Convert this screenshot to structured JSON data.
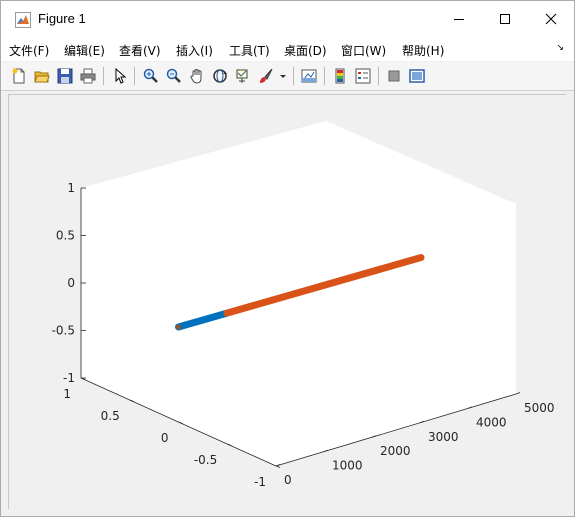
{
  "window": {
    "title": "Figure 1"
  },
  "menu": [
    "文件(F)",
    "编辑(E)",
    "查看(V)",
    "插入(I)",
    "工具(T)",
    "桌面(D)",
    "窗口(W)",
    "帮助(H)"
  ],
  "toolbar": {
    "icons": [
      "new-figure-icon",
      "open-file-icon",
      "save-icon",
      "print-icon",
      "pointer-icon",
      "zoom-in-icon",
      "zoom-out-icon",
      "pan-hand-icon",
      "rotate-3d-icon",
      "data-cursor-icon",
      "brush-icon",
      "brush-dropdown-icon",
      "link-plot-icon",
      "colorbar-icon",
      "legend-icon",
      "hide-plot-tools-icon",
      "show-plot-tools-icon"
    ]
  },
  "chart_data": {
    "type": "line",
    "title": "",
    "xlabel": "",
    "ylabel": "",
    "zlabel": "",
    "xlim": [
      0,
      5000
    ],
    "ylim": [
      -1,
      1
    ],
    "zlim": [
      -1,
      1
    ],
    "x_ticks": [
      "0",
      "1000",
      "2000",
      "3000",
      "4000",
      "5000"
    ],
    "y_ticks": [
      "-1",
      "-0.5",
      "0",
      "0.5",
      "1"
    ],
    "z_ticks": [
      "-1",
      "-0.5",
      "0",
      "0.5",
      "1"
    ],
    "grid": false,
    "view": "3d",
    "series": [
      {
        "color": "#0072BD",
        "x": [
          0,
          1000
        ],
        "y": [
          0,
          0
        ],
        "z": [
          0,
          0
        ]
      },
      {
        "color": "#D95319",
        "x": [
          1000,
          5000
        ],
        "y": [
          0,
          0
        ],
        "z": [
          0,
          0
        ]
      }
    ]
  }
}
